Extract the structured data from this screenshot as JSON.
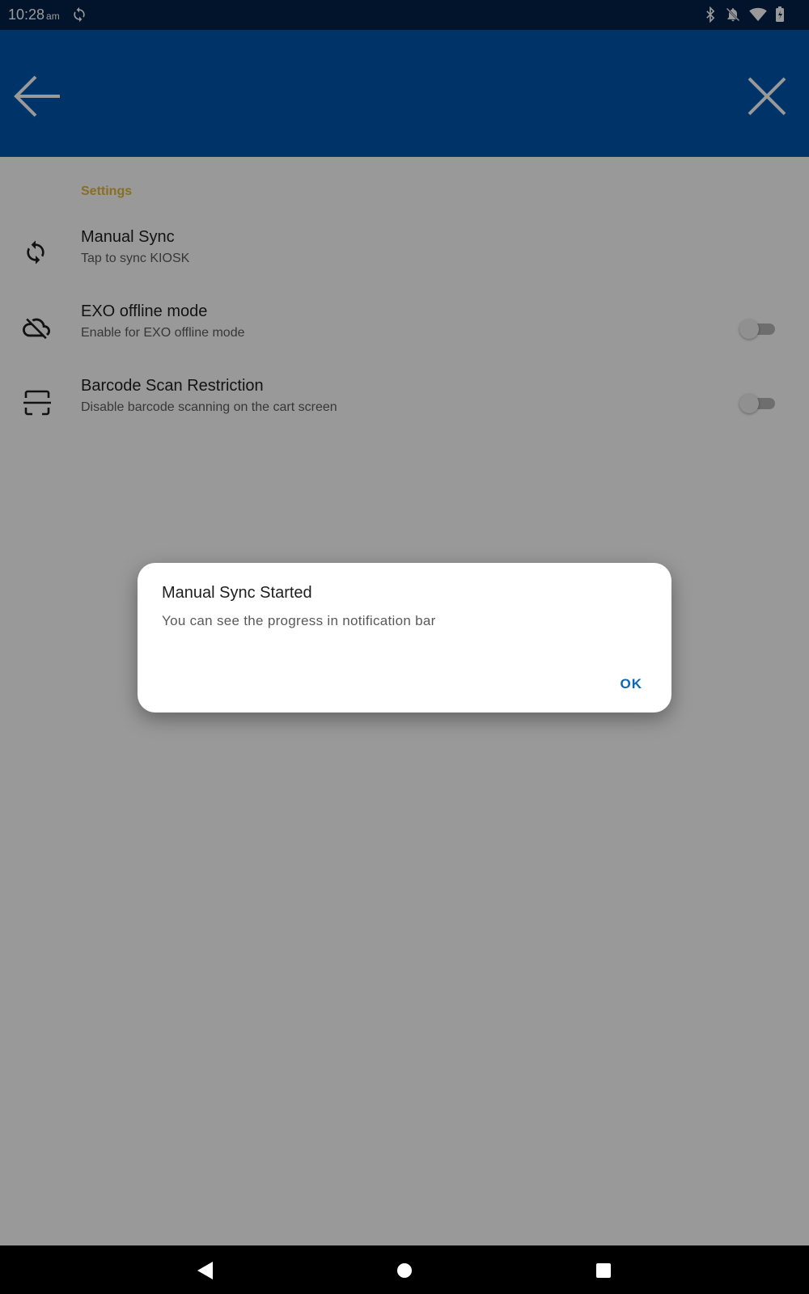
{
  "status_bar": {
    "time": "10:28",
    "ampm": "am",
    "icons": [
      "sync-icon",
      "bluetooth-icon",
      "notifications-off-icon",
      "wifi-icon",
      "battery-icon"
    ]
  },
  "app_bar": {
    "background": "#0055ae",
    "back_icon": "arrow-left-icon",
    "close_icon": "close-icon"
  },
  "settings": {
    "section_title": "Settings",
    "accent": "#e6b93a",
    "items": [
      {
        "title": "Manual Sync",
        "subtitle": "Tap to sync KIOSK",
        "icon": "sync-icon"
      },
      {
        "title": "EXO offline mode",
        "subtitle": "Enable for EXO offline mode",
        "icon": "cloud-off-icon",
        "toggle_on": false
      },
      {
        "title": "Barcode Scan Restriction",
        "subtitle": "Disable barcode scanning on the cart screen",
        "icon": "barcode-scanner-icon",
        "toggle_on": false
      }
    ]
  },
  "dialog": {
    "title": "Manual Sync Started",
    "message": "You can see the progress in notification bar",
    "ok_label": "OK",
    "ok_color": "#0a68b5"
  },
  "nav_bar": {
    "icons": [
      "back-triangle-icon",
      "home-circle-icon",
      "recents-square-icon"
    ]
  }
}
